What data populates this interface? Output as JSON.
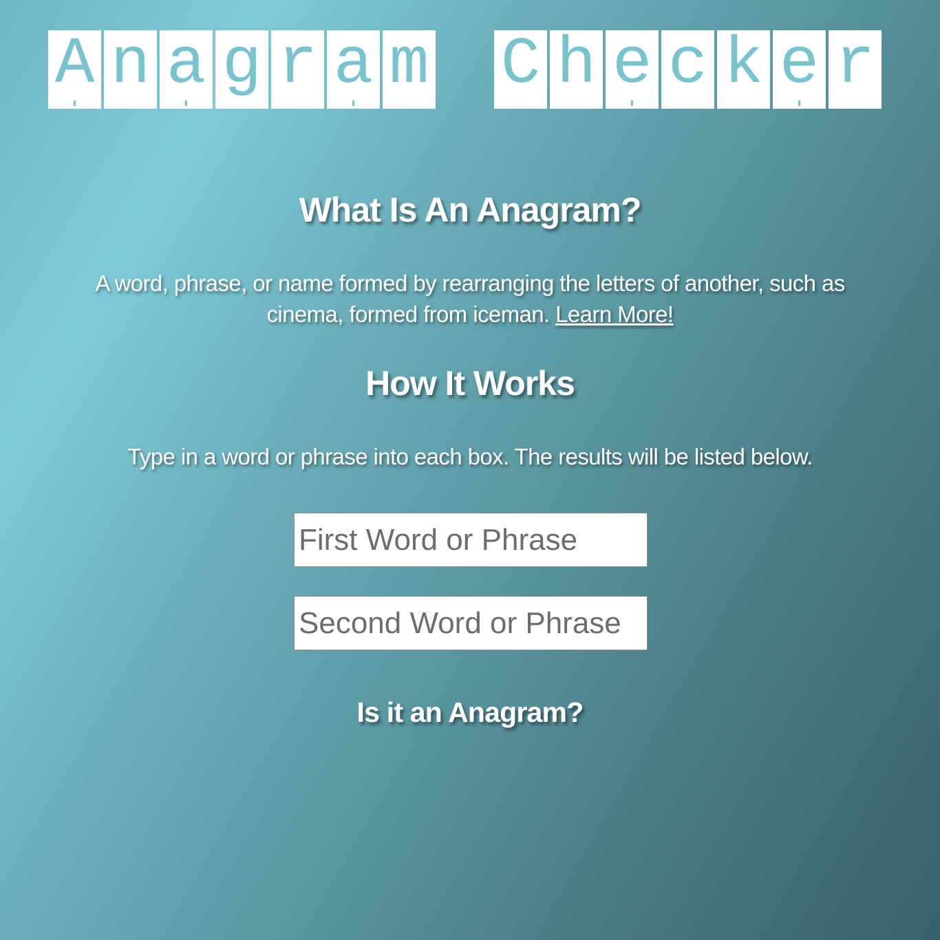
{
  "header": {
    "title_word_1": [
      "A",
      "n",
      "a",
      "g",
      "r",
      "a",
      "m"
    ],
    "title_word_2": [
      "C",
      "h",
      "e",
      "c",
      "k",
      "e",
      "r"
    ],
    "tile_color": "#ffffff",
    "letter_color": "#79c3cf"
  },
  "about": {
    "heading": "What Is An Anagram?",
    "definition": "A word, phrase, or name formed by rearranging the letters of another, such as cinema, formed from iceman.",
    "learn_more_link": "Learn More!"
  },
  "how": {
    "heading": "How It Works",
    "instructions": "Type in a word or phrase into each box. The results will be listed below."
  },
  "form": {
    "first_placeholder": "First Word or Phrase",
    "second_placeholder": "Second Word or Phrase",
    "submit_label": "Is it an Anagram?"
  },
  "theme": {
    "background_light": "#7dcad6",
    "background_dark": "#386068"
  }
}
